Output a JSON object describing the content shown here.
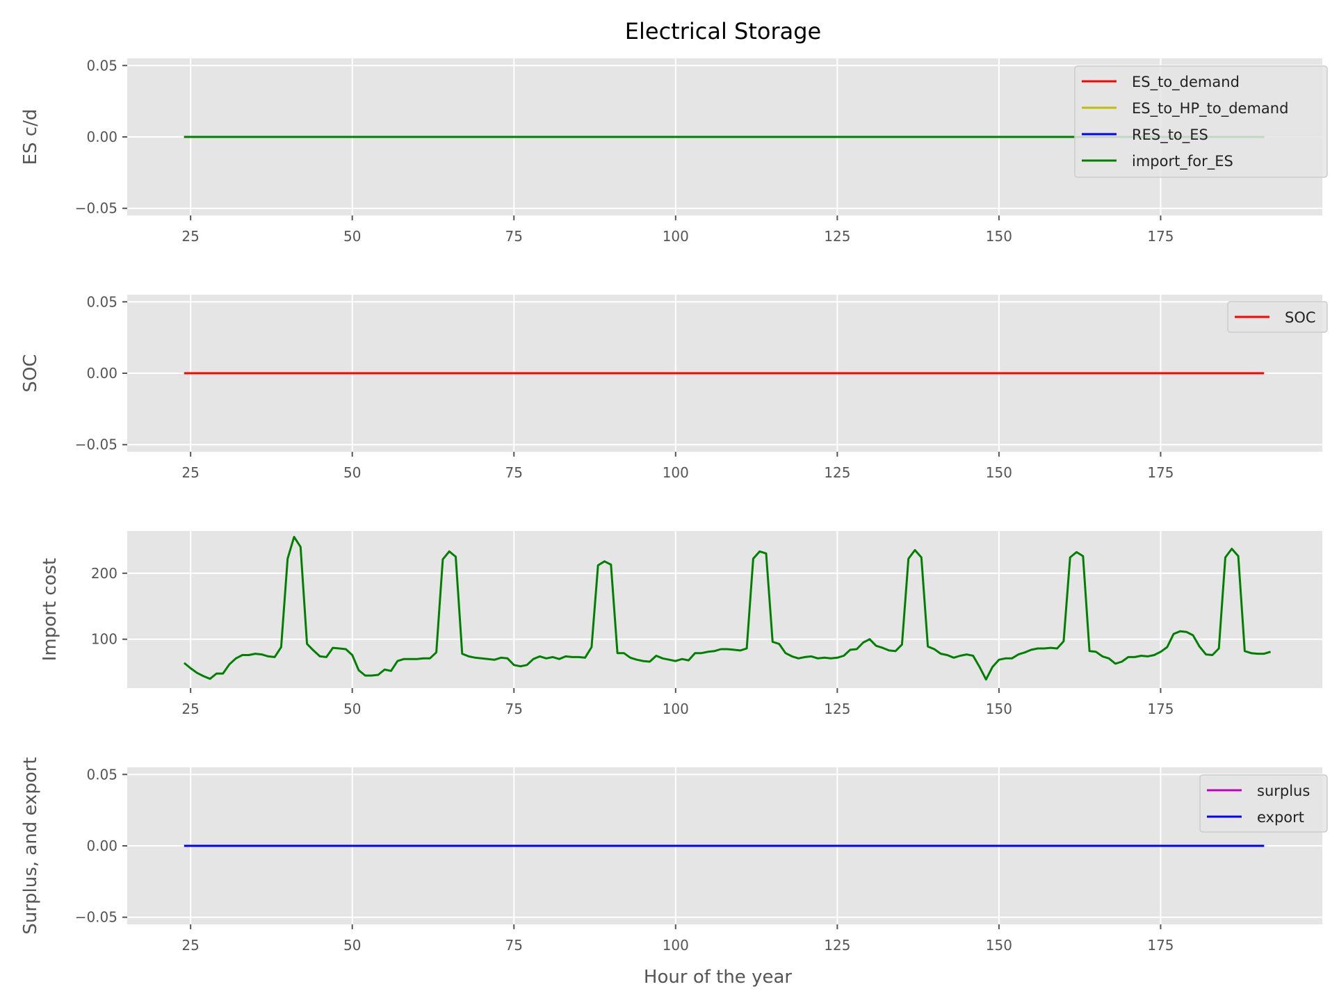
{
  "figure": {
    "title": "Electrical Storage"
  },
  "colors": {
    "panel_bg": "#e5e5e5",
    "grid": "#ffffff",
    "tick": "#555555",
    "legend_bg": "#e5e5e5",
    "legend_border": "#cccccc"
  },
  "chart_data": [
    {
      "type": "line",
      "ylabel": "ES c/d",
      "xlabel": "",
      "xlim": [
        15.2,
        200
      ],
      "ylim": [
        -0.055,
        0.055
      ],
      "xticks": [
        25,
        50,
        75,
        100,
        125,
        150,
        175
      ],
      "yticks": [
        0.05,
        0.0,
        -0.05
      ],
      "ytick_labels": [
        "0.05",
        "0.00",
        "−0.05"
      ],
      "grid": true,
      "legend_position": "upper-right",
      "series": [
        {
          "name": "ES_to_demand",
          "color": "#ff0000",
          "x_start": 24,
          "x_end": 191,
          "constant": 0
        },
        {
          "name": "ES_to_HP_to_demand",
          "color": "#bfbf00",
          "x_start": 24,
          "x_end": 191,
          "constant": 0
        },
        {
          "name": "RES_to_ES",
          "color": "#0000ff",
          "x_start": 24,
          "x_end": 191,
          "constant": 0
        },
        {
          "name": "import_for_ES",
          "color": "#008000",
          "x_start": 24,
          "x_end": 191,
          "constant": 0
        }
      ]
    },
    {
      "type": "line",
      "ylabel": "SOC",
      "xlabel": "",
      "xlim": [
        15.2,
        200
      ],
      "ylim": [
        -0.055,
        0.055
      ],
      "xticks": [
        25,
        50,
        75,
        100,
        125,
        150,
        175
      ],
      "yticks": [
        0.05,
        0.0,
        -0.05
      ],
      "ytick_labels": [
        "0.05",
        "0.00",
        "−0.05"
      ],
      "grid": true,
      "legend_position": "upper-right",
      "series": [
        {
          "name": "SOC",
          "color": "#ff0000",
          "x_start": 24,
          "x_end": 191,
          "constant": 0
        }
      ]
    },
    {
      "type": "line",
      "ylabel": "Import cost",
      "xlabel": "",
      "xlim": [
        15.2,
        200
      ],
      "ylim": [
        26,
        264
      ],
      "xticks": [
        25,
        50,
        75,
        100,
        125,
        150,
        175
      ],
      "yticks": [
        200,
        100
      ],
      "ytick_labels": [
        "200",
        "100"
      ],
      "grid": true,
      "series": [
        {
          "name": "",
          "color": "#008000",
          "x_start": 24,
          "values": [
            64,
            56,
            49,
            44,
            40,
            48,
            48,
            62,
            71,
            76,
            76,
            78,
            77,
            74,
            73,
            88,
            222,
            255,
            240,
            93,
            83,
            74,
            73,
            87,
            86,
            85,
            76,
            53,
            45,
            45,
            46,
            54,
            52,
            67,
            70,
            70,
            70,
            71,
            71,
            80,
            221,
            233,
            225,
            78,
            74,
            72,
            71,
            70,
            69,
            72,
            71,
            61,
            59,
            61,
            70,
            74,
            71,
            73,
            70,
            74,
            73,
            73,
            72,
            88,
            212,
            218,
            213,
            79,
            79,
            72,
            69,
            67,
            66,
            75,
            71,
            69,
            67,
            70,
            68,
            79,
            79,
            81,
            82,
            85,
            85,
            84,
            83,
            86,
            222,
            233,
            230,
            96,
            93,
            79,
            74,
            71,
            73,
            74,
            71,
            72,
            71,
            72,
            75,
            84,
            85,
            95,
            100,
            90,
            87,
            83,
            82,
            92,
            222,
            235,
            224,
            89,
            85,
            78,
            76,
            72,
            75,
            77,
            75,
            58,
            39,
            58,
            69,
            71,
            71,
            77,
            80,
            84,
            86,
            86,
            87,
            86,
            97,
            224,
            232,
            226,
            82,
            81,
            74,
            71,
            63,
            66,
            73,
            73,
            75,
            74,
            76,
            81,
            88,
            108,
            112,
            111,
            106,
            89,
            77,
            76,
            86,
            224,
            237,
            226,
            82,
            79,
            78,
            78,
            81
          ]
        }
      ]
    },
    {
      "type": "line",
      "ylabel": "Surplus, and export",
      "xlabel": "Hour of the year",
      "xlim": [
        15.2,
        200
      ],
      "ylim": [
        -0.055,
        0.055
      ],
      "xticks": [
        25,
        50,
        75,
        100,
        125,
        150,
        175
      ],
      "yticks": [
        0.05,
        0.0,
        -0.05
      ],
      "ytick_labels": [
        "0.05",
        "0.00",
        "−0.05"
      ],
      "grid": true,
      "legend_position": "upper-right",
      "series": [
        {
          "name": "surplus",
          "color": "#bf00bf",
          "x_start": 24,
          "x_end": 191,
          "constant": 0
        },
        {
          "name": "export",
          "color": "#0000ff",
          "x_start": 24,
          "x_end": 191,
          "constant": 0
        }
      ]
    }
  ]
}
